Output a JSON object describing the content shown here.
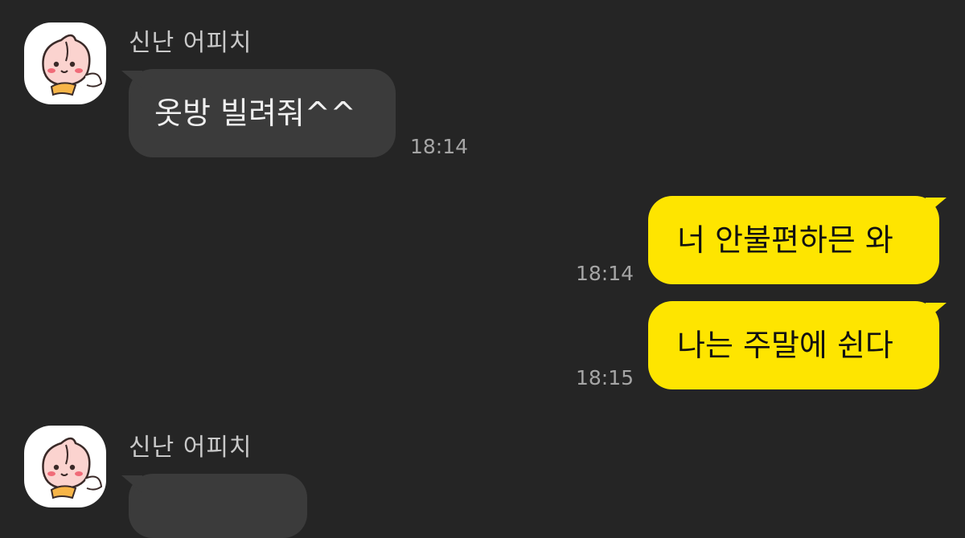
{
  "chat": {
    "messages": [
      {
        "type": "incoming",
        "sender": "신난 어피치",
        "text": "옷방 빌려줘^^",
        "time": "18:14"
      },
      {
        "type": "outgoing",
        "text": "너 안불편하믄 와",
        "time": "18:14"
      },
      {
        "type": "outgoing",
        "text": "나는 주말에 쉰다",
        "time": "18:15"
      },
      {
        "type": "incoming",
        "sender": "신난 어피치",
        "text": "",
        "time": ""
      }
    ]
  },
  "colors": {
    "background": "#252525",
    "incoming_bubble": "#3b3b3b",
    "outgoing_bubble": "#fee500",
    "timestamp": "#a5a5a5"
  },
  "icons": {
    "avatar": "apeach-avatar-icon"
  }
}
